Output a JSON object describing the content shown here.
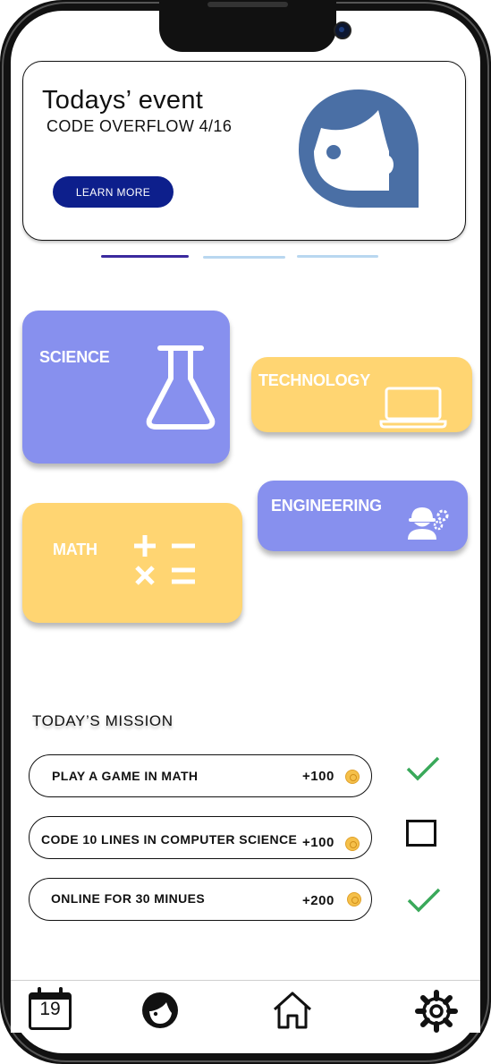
{
  "event": {
    "title": "Todays’ event",
    "subtitle": "CODE OVERFLOW 4/16",
    "button_label": "LEARN MORE"
  },
  "carousel": {
    "pages": 3,
    "active": 1
  },
  "subjects": {
    "science": {
      "label": "SCIENCE",
      "color": "#8790ee",
      "icon": "flask-icon"
    },
    "technology": {
      "label": "TECHNOLOGY",
      "color": "#ffd572",
      "icon": "laptop-icon"
    },
    "engineering": {
      "label": "ENGINEERING",
      "color": "#8790ee",
      "icon": "engineer-icon"
    },
    "math": {
      "label": "MATH",
      "color": "#ffd572",
      "icon": "math-operators-icon"
    }
  },
  "missions": {
    "title": "TODAY’S MISSION",
    "items": [
      {
        "text": "PLAY A GAME IN MATH",
        "points": "+100",
        "status": "done"
      },
      {
        "text": "CODE 10 LINES IN COMPUTER SCIENCE",
        "points": "+100",
        "status": "pending"
      },
      {
        "text": "ONLINE FOR 30 MINUES",
        "points": "+200",
        "status": "done"
      }
    ]
  },
  "nav": {
    "calendar_day": "19",
    "items": [
      "calendar-icon",
      "profile-icon",
      "home-icon",
      "settings-icon"
    ]
  },
  "colors": {
    "accent": "#0d1f8c",
    "check": "#3aa95a",
    "avatar": "#4a6fa5"
  }
}
